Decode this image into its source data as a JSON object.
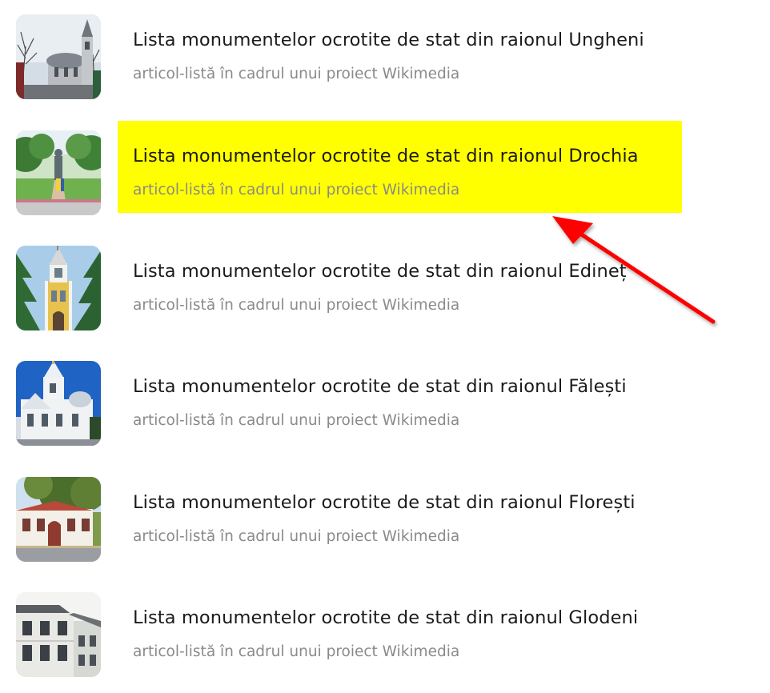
{
  "results": [
    {
      "title": "Lista monumentelor ocrotite de stat din raionul Ungheni",
      "description": "articol-listă în cadrul unui proiect Wikimedia",
      "thumbnail_icon": "church-thumbnail-icon"
    },
    {
      "title": "Lista monumentelor ocrotite de stat din raionul Drochia",
      "description": "articol-listă în cadrul unui proiect Wikimedia",
      "thumbnail_icon": "monument-park-thumbnail-icon",
      "highlighted": true,
      "highlight_color": "#ffff00"
    },
    {
      "title": "Lista monumentelor ocrotite de stat din raionul Edineț",
      "description": "articol-listă în cadrul unui proiect Wikimedia",
      "thumbnail_icon": "church-tower-thumbnail-icon"
    },
    {
      "title": "Lista monumentelor ocrotite de stat din raionul Fălești",
      "description": "articol-listă în cadrul unui proiect Wikimedia",
      "thumbnail_icon": "church-thumbnail-icon"
    },
    {
      "title": "Lista monumentelor ocrotite de stat din raionul Florești",
      "description": "articol-listă în cadrul unui proiect Wikimedia",
      "thumbnail_icon": "building-thumbnail-icon"
    },
    {
      "title": "Lista monumentelor ocrotite de stat din raionul Glodeni",
      "description": "articol-listă în cadrul unui proiect Wikimedia",
      "thumbnail_icon": "building-thumbnail-icon"
    }
  ],
  "annotation": {
    "arrow_icon": "red-arrow-icon",
    "arrow_color": "#ff0000"
  },
  "colors": {
    "title_text": "#1b1b1b",
    "description_text": "#8a8a8a",
    "background": "#ffffff"
  }
}
